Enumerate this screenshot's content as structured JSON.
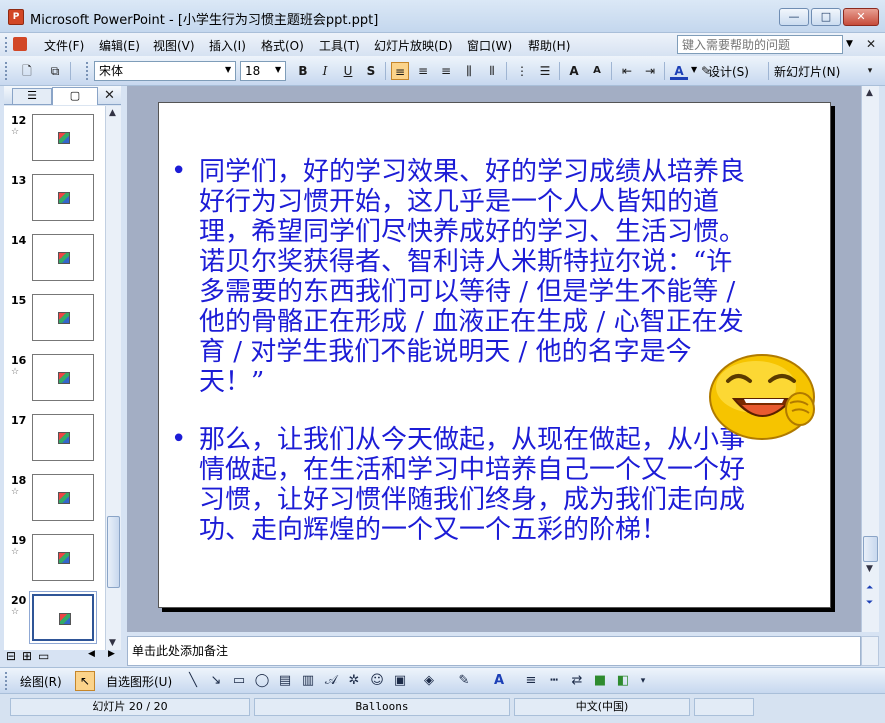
{
  "window": {
    "app_icon": "P",
    "title": "Microsoft PowerPoint - [小学生行为习惯主题班会ppt.ppt]",
    "controls": {
      "minimize": "—",
      "maximize": "□",
      "close": "✕"
    }
  },
  "menubar": {
    "items": [
      "文件(F)",
      "编辑(E)",
      "视图(V)",
      "插入(I)",
      "格式(O)",
      "工具(T)",
      "幻灯片放映(D)",
      "窗口(W)",
      "帮助(H)"
    ],
    "help_placeholder": "键入需要帮助的问题",
    "close_glyph": "✕"
  },
  "toolbar": {
    "font_name": "宋体",
    "font_size": "18",
    "design_label": "设计(S)",
    "new_slide_label": "新幻灯片(N)"
  },
  "left_pane": {
    "tab_outline": "☰",
    "tab_slides": "▢",
    "close_glyph": "✕",
    "thumbnails": [
      {
        "number": "12",
        "star": "☆"
      },
      {
        "number": "13",
        "star": ""
      },
      {
        "number": "14",
        "star": ""
      },
      {
        "number": "15",
        "star": ""
      },
      {
        "number": "16",
        "star": "☆"
      },
      {
        "number": "17",
        "star": ""
      },
      {
        "number": "18",
        "star": "☆"
      },
      {
        "number": "19",
        "star": "☆"
      },
      {
        "number": "20",
        "star": "☆"
      }
    ],
    "selected_slide": "20"
  },
  "slide": {
    "paragraphs": [
      "同学们，好的学习效果、好的学习成绩从培养良好行为习惯开始，这几乎是一个人人皆知的道理，希望同学们尽快养成好的学习、生活习惯。诺贝尔奖获得者、智利诗人米斯特拉尔说：“许多需要的东西我们可以等待 / 但是学生不能等 / 他的骨骼正在形成 / 血液正在生成 / 心智正在发育 / 对学生我们不能说明天 / 他的名字是今天！”",
      "那么，让我们从今天做起，从现在做起，从小事情做起，在生活和学习中培养自己一个又一个好习惯，让好习惯伴随我们终身，成为我们走向成功、走向辉煌的一个又一个五彩的阶梯！"
    ],
    "text_color": "#1c1cd6"
  },
  "notes": {
    "placeholder": "单击此处添加备注"
  },
  "drawbar": {
    "draw_label": "绘图(R)",
    "autoshape_label": "自选图形(U)"
  },
  "statusbar": {
    "slide_position": "幻灯片 20 / 20",
    "design_template": "Balloons",
    "language": "中文(中国)"
  }
}
